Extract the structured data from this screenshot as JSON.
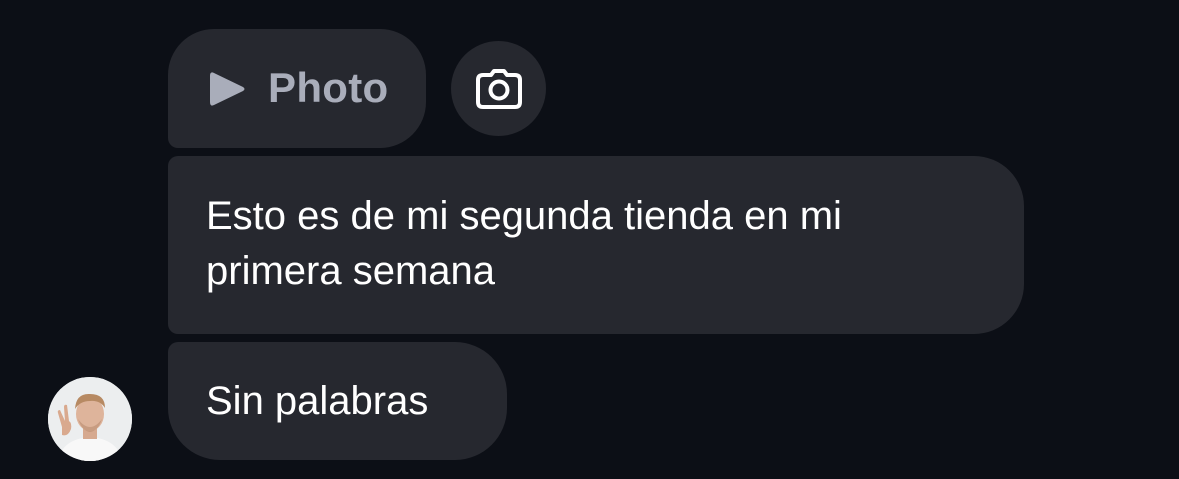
{
  "messages": {
    "photo_label": "Photo",
    "long_text": "Esto es de mi segunda tienda en mi primera semana",
    "short_text": "Sin palabras"
  },
  "icons": {
    "play": "play-icon",
    "camera": "camera-icon",
    "avatar": "user-avatar"
  },
  "colors": {
    "background": "#0c0f16",
    "bubble": "#26282f",
    "text": "#ffffff",
    "photo_label": "#a9adba"
  }
}
